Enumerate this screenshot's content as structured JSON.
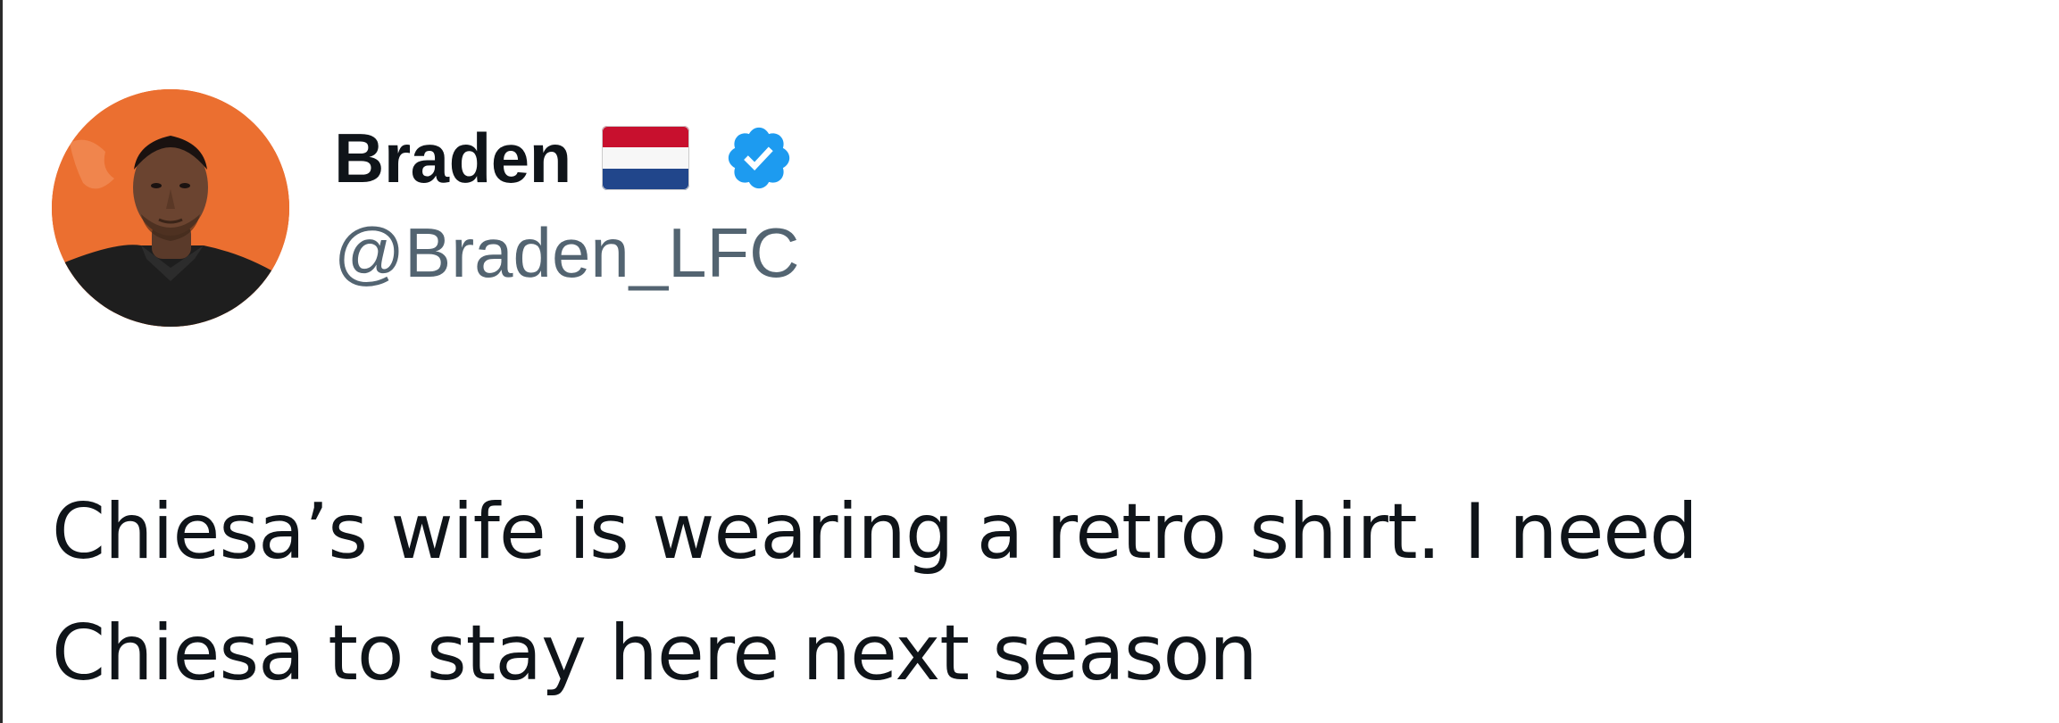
{
  "tweet": {
    "author": {
      "display_name": "Braden",
      "handle": "@Braden_LFC",
      "flag": "netherlands-flag-icon",
      "verified": true,
      "verified_color": "#1d9bf0"
    },
    "text_lines": [
      "Chiesa’s wife is wearing a retro shirt. I need",
      "Chiesa to stay here next season"
    ]
  },
  "colors": {
    "text_primary": "#0f1419",
    "text_secondary": "#536471",
    "avatar_background": "#e8692c"
  }
}
